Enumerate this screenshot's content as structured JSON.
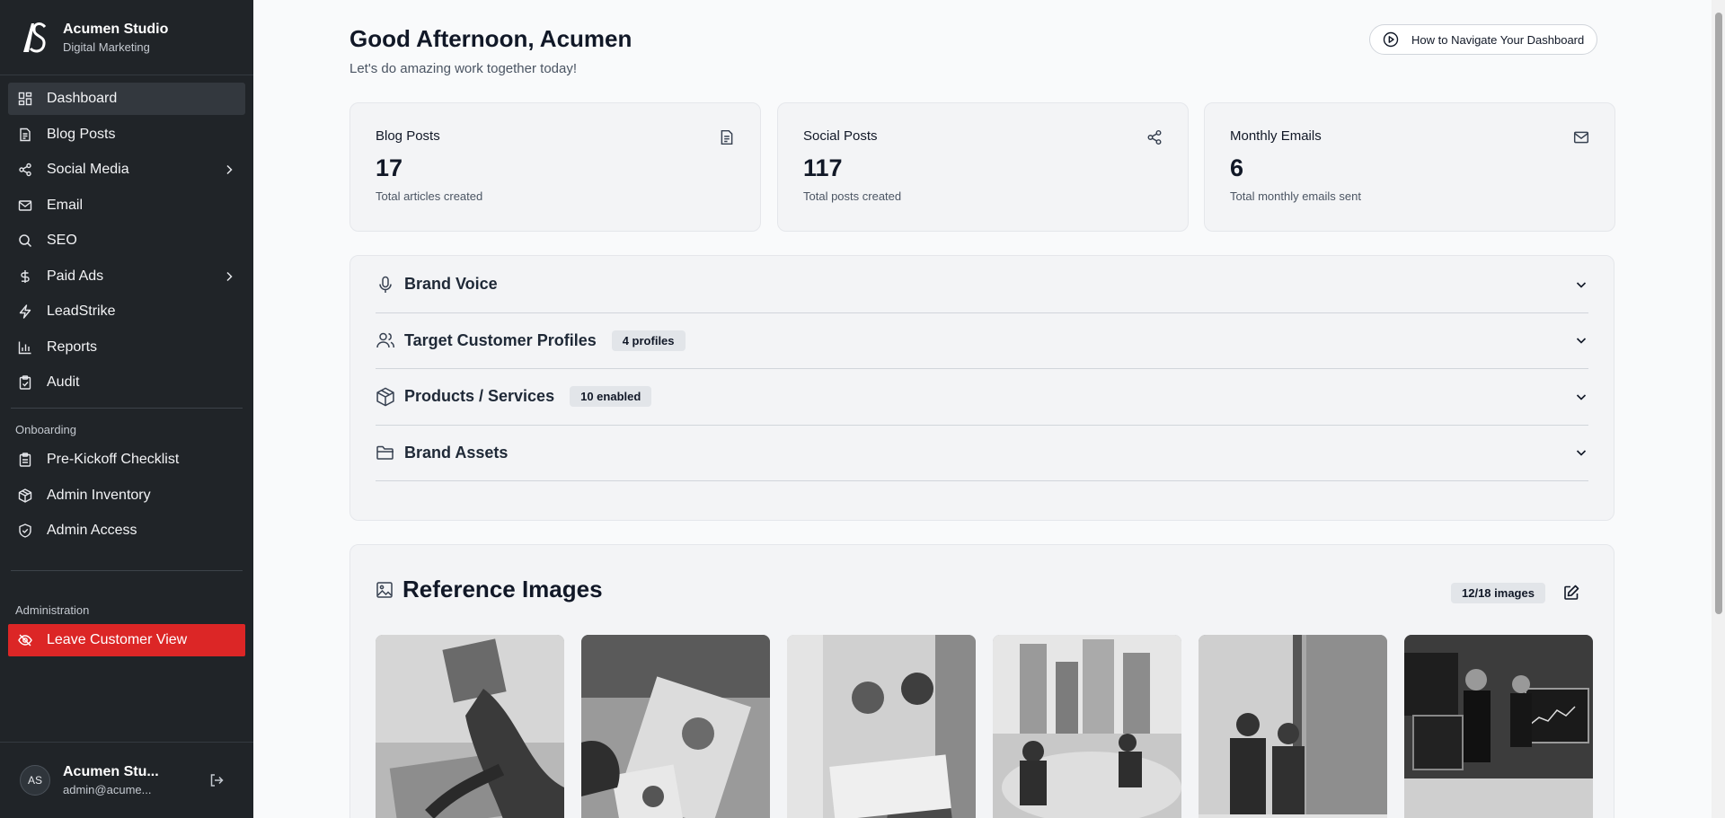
{
  "brand": {
    "logo_text": "AS",
    "name": "Acumen Studio",
    "subtitle": "Digital Marketing"
  },
  "sidebar": {
    "items": [
      {
        "label": "Dashboard",
        "icon": "dashboard-icon",
        "active": true
      },
      {
        "label": "Blog Posts",
        "icon": "document-icon"
      },
      {
        "label": "Social Media",
        "icon": "share-icon",
        "has_submenu": true
      },
      {
        "label": "Email",
        "icon": "mail-icon"
      },
      {
        "label": "SEO",
        "icon": "search-icon"
      },
      {
        "label": "Paid Ads",
        "icon": "dollar-icon",
        "has_submenu": true
      },
      {
        "label": "LeadStrike",
        "icon": "lightning-icon"
      },
      {
        "label": "Reports",
        "icon": "bar-chart-icon"
      },
      {
        "label": "Audit",
        "icon": "clipboard-check-icon"
      }
    ],
    "onboarding_label": "Onboarding",
    "onboarding_items": [
      {
        "label": "Pre-Kickoff Checklist",
        "icon": "clipboard-icon"
      },
      {
        "label": "Admin Inventory",
        "icon": "box-icon"
      },
      {
        "label": "Admin Access",
        "icon": "shield-check-icon"
      }
    ],
    "administration_label": "Administration",
    "leave_label": "Leave Customer View"
  },
  "user": {
    "initials": "AS",
    "name": "Acumen Stu...",
    "email": "admin@acume..."
  },
  "header": {
    "greeting": "Good Afternoon, Acumen",
    "subgreeting": "Let's do amazing work together today!",
    "howto_label": "How to Navigate Your Dashboard"
  },
  "stats": [
    {
      "title": "Blog Posts",
      "value": "17",
      "desc": "Total articles created",
      "icon": "document-icon"
    },
    {
      "title": "Social Posts",
      "value": "117",
      "desc": "Total posts created",
      "icon": "share-icon"
    },
    {
      "title": "Monthly Emails",
      "value": "6",
      "desc": "Total monthly emails sent",
      "icon": "mail-icon"
    }
  ],
  "accordion": [
    {
      "title": "Brand Voice",
      "icon": "microphone-icon",
      "badge": ""
    },
    {
      "title": "Target Customer Profiles",
      "icon": "users-icon",
      "badge": "4 profiles"
    },
    {
      "title": "Products / Services",
      "icon": "box-icon",
      "badge": "10 enabled"
    },
    {
      "title": "Brand Assets",
      "icon": "folder-icon",
      "badge": ""
    }
  ],
  "references": {
    "title": "Reference Images",
    "count": "12/18 images"
  },
  "colors": {
    "sidebar_bg": "#202428",
    "danger": "#dc2626",
    "page_bg": "#f9fafb",
    "card_bg": "#f3f4f6"
  }
}
